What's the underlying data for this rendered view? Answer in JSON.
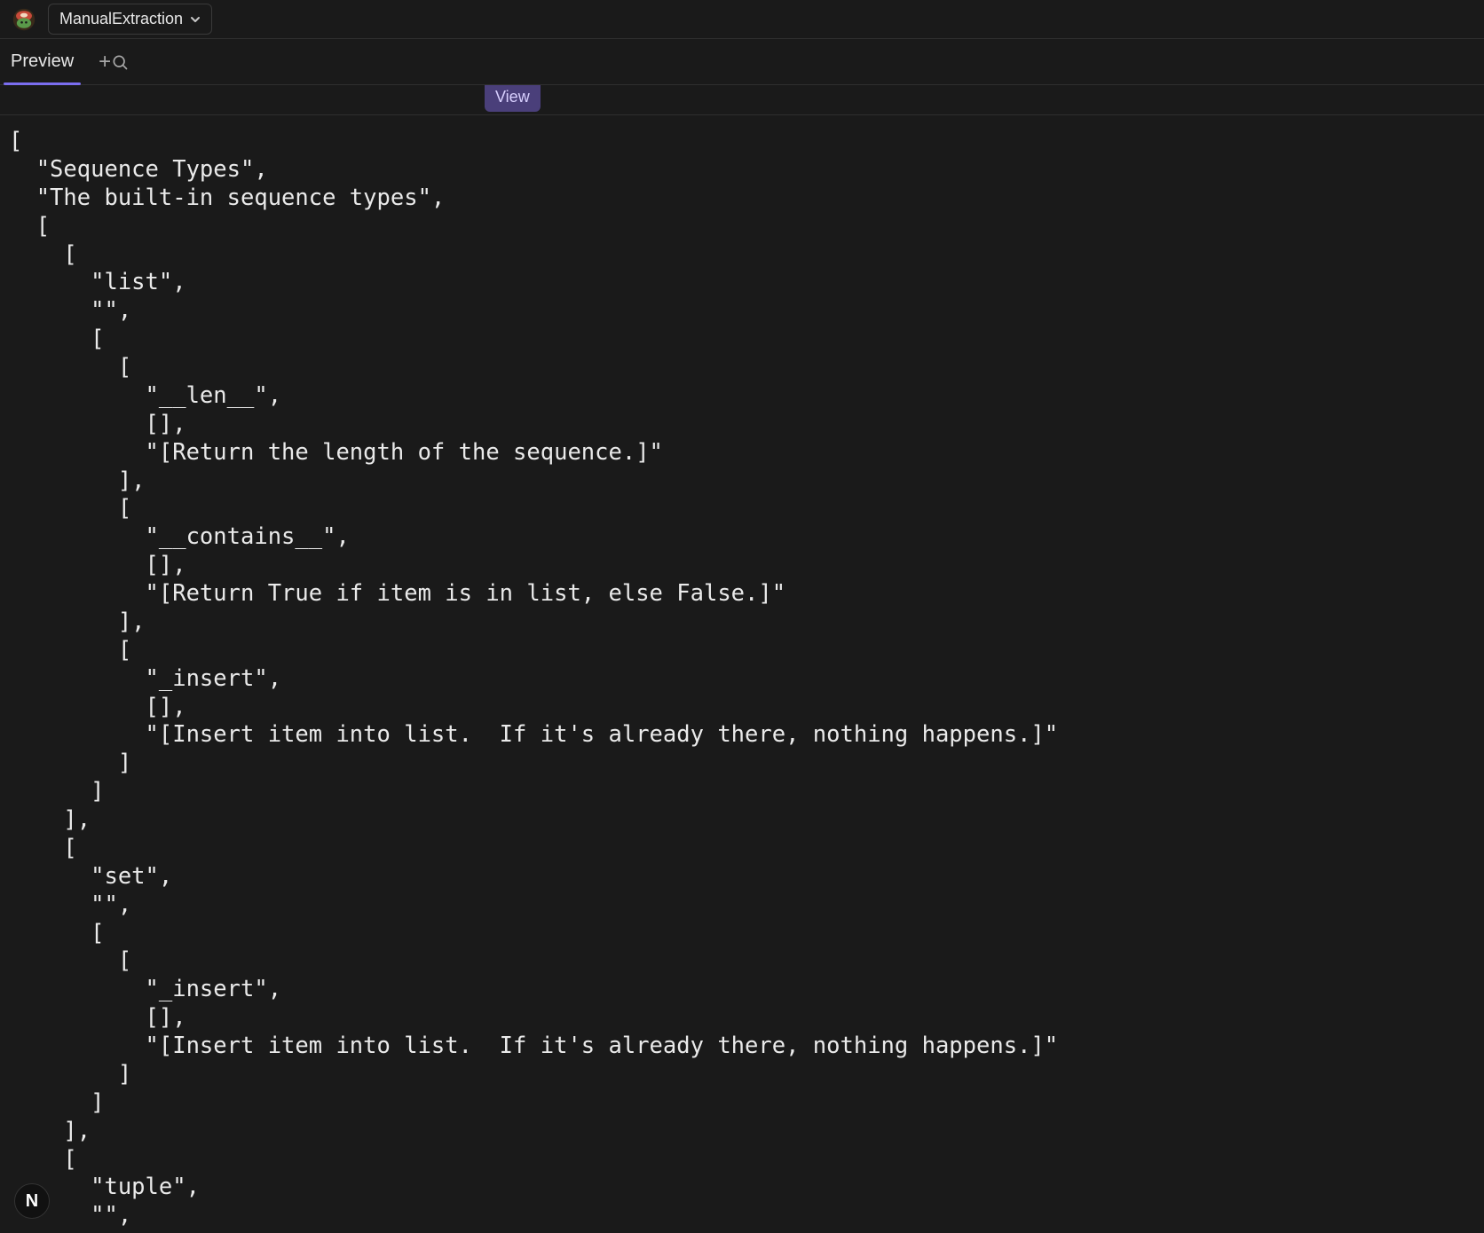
{
  "header": {
    "dropdown_label": "ManualExtraction"
  },
  "tabs": {
    "preview_label": "Preview"
  },
  "badge": {
    "view_label": "View"
  },
  "float": {
    "label": "N"
  },
  "code_lines": [
    "[",
    "  \"Sequence Types\",",
    "  \"The built-in sequence types\",",
    "  [",
    "    [",
    "      \"list\",",
    "      \"\",",
    "      [",
    "        [",
    "          \"__len__\",",
    "          [],",
    "          \"[Return the length of the sequence.]\"",
    "        ],",
    "        [",
    "          \"__contains__\",",
    "          [],",
    "          \"[Return True if item is in list, else False.]\"",
    "        ],",
    "        [",
    "          \"_insert\",",
    "          [],",
    "          \"[Insert item into list.  If it's already there, nothing happens.]\"",
    "        ]",
    "      ]",
    "    ],",
    "    [",
    "      \"set\",",
    "      \"\",",
    "      [",
    "        [",
    "          \"_insert\",",
    "          [],",
    "          \"[Insert item into list.  If it's already there, nothing happens.]\"",
    "        ]",
    "      ]",
    "    ],",
    "    [",
    "      \"tuple\",",
    "      \"\","
  ]
}
